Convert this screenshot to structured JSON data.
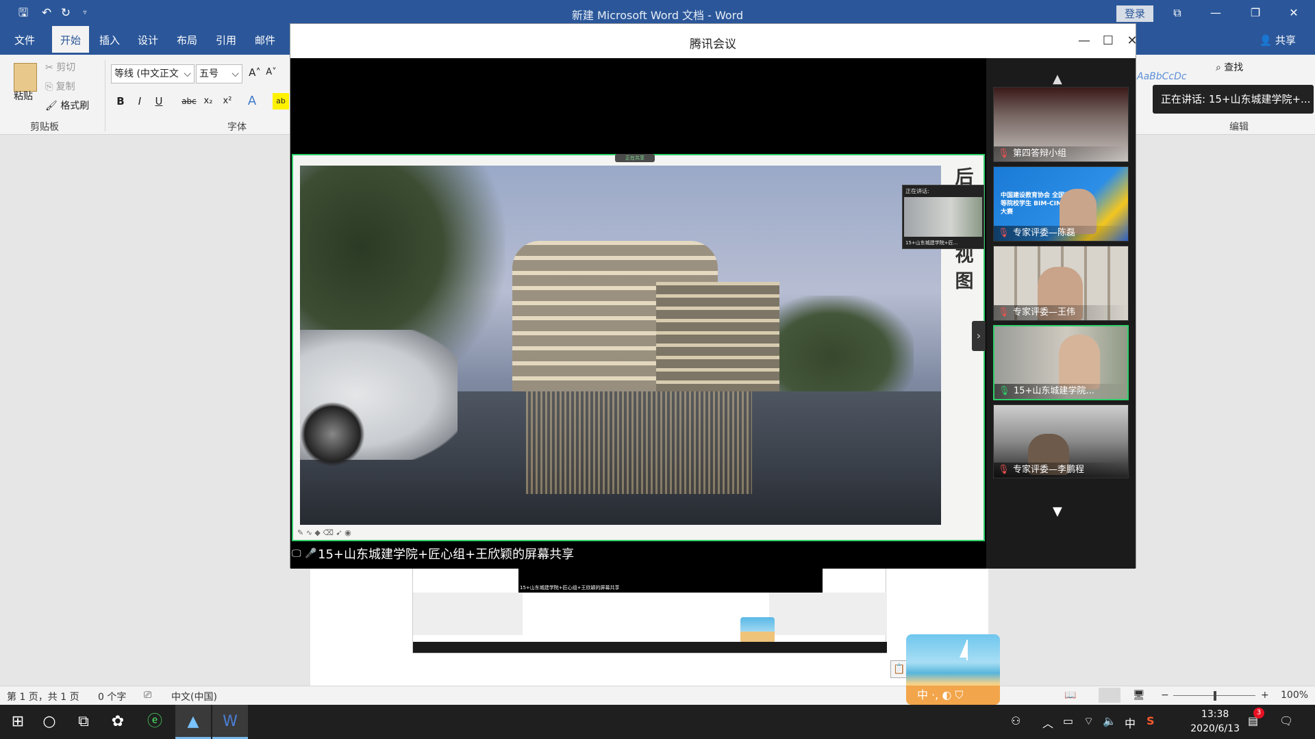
{
  "word": {
    "title": "新建 Microsoft Word 文档 - Word",
    "login": "登录",
    "share": "共享",
    "tabs": [
      "文件",
      "开始",
      "插入",
      "设计",
      "布局",
      "引用",
      "邮件"
    ],
    "ribbon": {
      "paste": "粘贴",
      "cut": "剪切",
      "copy": "复制",
      "format_painter": "格式刷",
      "clipboard_group": "剪贴板",
      "font_name": "等线 (中文正文",
      "font_size": "五号",
      "font_group": "字体",
      "find": "查找",
      "edit_group": "编辑",
      "styles_preview": "AaBbCcDc"
    },
    "status": {
      "page": "第 1 页，共 1 页",
      "words": "0 个字",
      "language": "中文(中国)",
      "zoom": "100%"
    }
  },
  "meeting": {
    "title": "腾讯会议",
    "slide_side_text": "后 入 口 视 图",
    "slide_pill": "正在共享",
    "speaking_label": "正在讲话:",
    "speaking_name": "15+山东城建学院+匠...",
    "share_caption": "15+山东城建学院+匠心组+王欣颖的屏幕共享",
    "participants": [
      {
        "name": "第四答辩小组",
        "mic": "muted"
      },
      {
        "name": "专家评委—陈磊",
        "mic": "muted"
      },
      {
        "name": "专家评委—王伟",
        "mic": "muted"
      },
      {
        "name": "15+山东城建学院...",
        "mic": "on"
      },
      {
        "name": "专家评委—李鹏程",
        "mic": "muted"
      }
    ],
    "tile2_text": "中国建设教育协会 全国高等院校学生 BIM-CIM创新大赛",
    "speaker_tooltip": "正在讲话: 15+山东城建学院+..."
  },
  "nested": {
    "caption": "15+山东城建学院+匠心组+王欣颖的屏幕共享"
  },
  "beach_widget": {
    "label": "中 ·, ◐ ⛉"
  },
  "taskbar": {
    "time": "13:38",
    "date": "2020/6/13",
    "ime": "中",
    "notif_count": "3"
  }
}
